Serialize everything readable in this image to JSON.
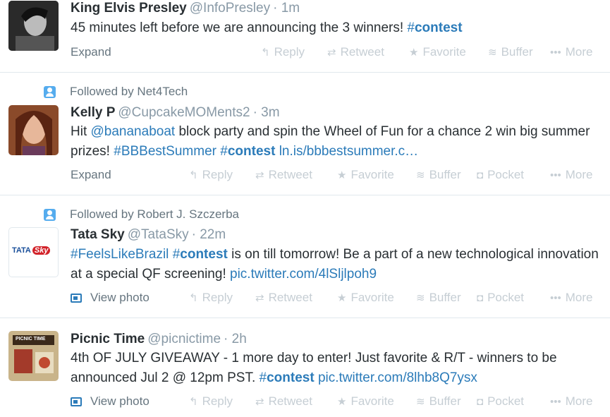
{
  "tweets": [
    {
      "name": "King Elvis Presley",
      "handle": "@InfoPresley",
      "time": "· 1m",
      "text_plain": "45 minutes left before we are announcing the 3 winners! ",
      "hashtag_hash": "#",
      "hashtag_word": "contest",
      "first_action": "Expand",
      "actions": [
        "Reply",
        "Retweet",
        "Favorite",
        "Buffer",
        "More"
      ]
    },
    {
      "context": "Followed by Net4Tech",
      "name": "Kelly P",
      "handle": "@CupcakeMOMents2",
      "time": "· 3m",
      "text_a": "Hit ",
      "mention": "@bananaboat",
      "text_b": " block party and spin the Wheel of Fun for a chance 2 win big summer prizes! ",
      "hashtag1": "#BBBestSummer",
      "hashtag2_hash": "#",
      "hashtag2_word": "contest",
      "link": "ln.is/bbbestsummer.c…",
      "first_action": "Expand",
      "actions": [
        "Reply",
        "Retweet",
        "Favorite",
        "Buffer",
        "Pocket",
        "More"
      ]
    },
    {
      "context": "Followed by Robert J. Szczerba",
      "name": "Tata Sky",
      "handle": "@TataSky",
      "time": "· 22m",
      "hashtag1": "#FeelsLikeBrazil",
      "hashtag2_hash": "#",
      "hashtag2_word": "contest",
      "text_a": " is on till tomorrow! Be a part of a new technological innovation at a special QF screening! ",
      "link": "pic.twitter.com/4lSljlpoh9",
      "first_action": "View photo",
      "actions": [
        "Reply",
        "Retweet",
        "Favorite",
        "Buffer",
        "Pocket",
        "More"
      ],
      "avatar_text_a": "TATA",
      "avatar_text_b": "Sky"
    },
    {
      "name": "Picnic Time",
      "handle": "@picnictime",
      "time": "· 2h",
      "text_a": "4th OF JULY GIVEAWAY - 1 more day to enter! Just favorite & R/T - winners to be announced Jul 2 @ 12pm PST. ",
      "hashtag_hash": "#",
      "hashtag_word": "contest",
      "link": "pic.twitter.com/8lhb8Q7ysx",
      "first_action": "View photo",
      "actions": [
        "Reply",
        "Retweet",
        "Favorite",
        "Buffer",
        "Pocket",
        "More"
      ],
      "avatar_text": "PICNIC TIME"
    }
  ],
  "icons": {
    "reply": "↰",
    "retweet": "⇄",
    "favorite": "★",
    "buffer": "≋",
    "pocket": "◘",
    "more": "•••"
  }
}
